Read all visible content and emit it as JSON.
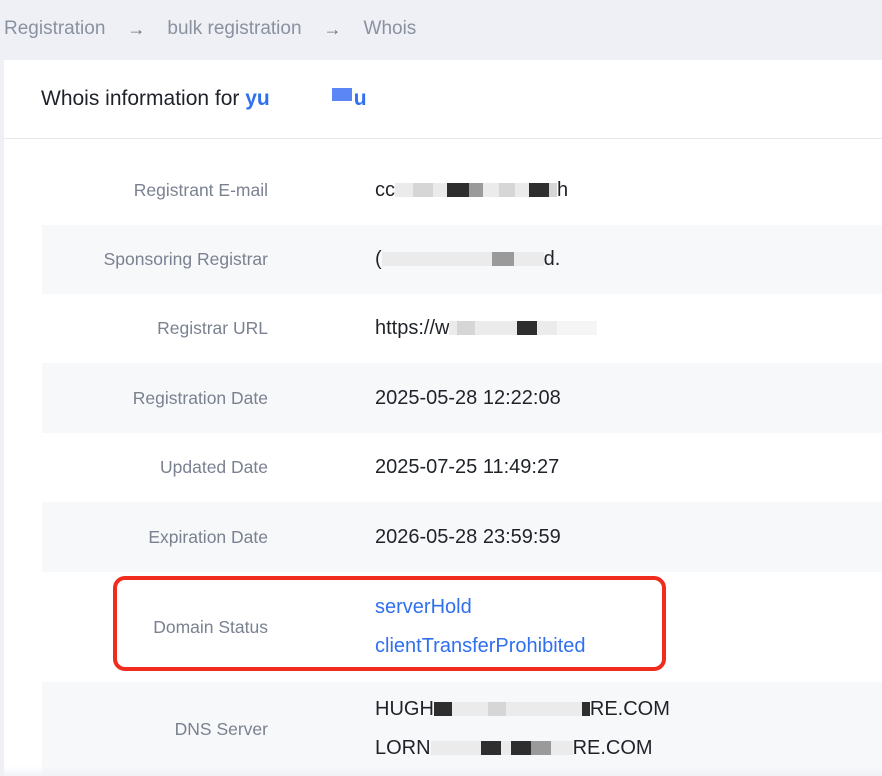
{
  "breadcrumb": {
    "items": [
      "Registration",
      "bulk registration",
      "Whois"
    ],
    "separator": "→"
  },
  "header": {
    "title_prefix": "Whois information for",
    "domain_start": "yu",
    "domain_end": "u"
  },
  "fields": {
    "registrant_email": {
      "label": "Registrant E-mail",
      "start": "cc",
      "end": "h"
    },
    "sponsoring_registrar": {
      "label": "Sponsoring Registrar",
      "start": "(",
      "end": "d."
    },
    "registrar_url": {
      "label": "Registrar URL",
      "start": "https://w"
    },
    "registration_date": {
      "label": "Registration Date",
      "value": "2025-05-28 12:22:08"
    },
    "updated_date": {
      "label": "Updated Date",
      "value": "2025-07-25 11:49:27"
    },
    "expiration_date": {
      "label": "Expiration Date",
      "value": "2026-05-28 23:59:59"
    },
    "domain_status": {
      "label": "Domain Status",
      "values": [
        "serverHold",
        "clientTransferProhibited"
      ]
    },
    "dns_server": {
      "label": "DNS Server",
      "ns1_start": "HUGH",
      "ns1_end": "RE.COM",
      "ns2_start": "LORN",
      "ns2_end": "RE.COM"
    }
  },
  "colors": {
    "link": "#2f6ff0",
    "highlight_border": "#f02c1e",
    "label": "#7a8190",
    "row_shade": "#f7f8fa"
  }
}
